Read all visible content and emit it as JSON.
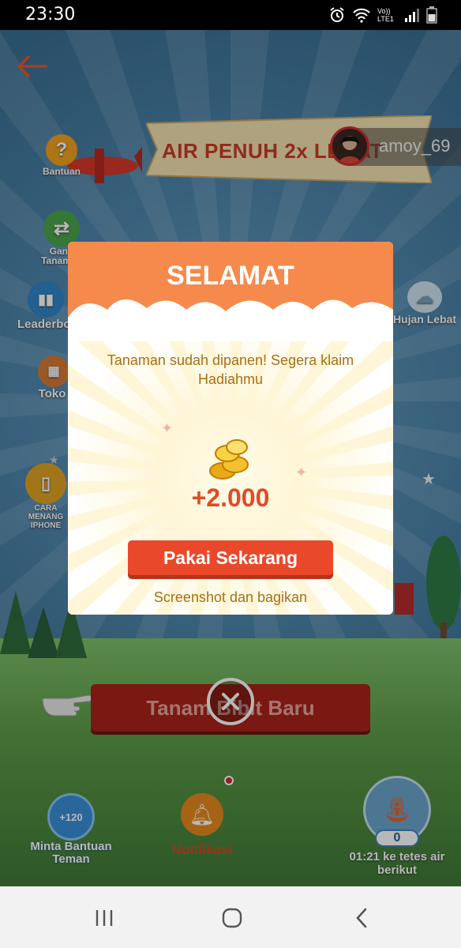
{
  "status_bar": {
    "time": "23:30",
    "network_label": "Vo)) LTE1"
  },
  "game": {
    "banner_text": "AIR PENUH 2x LEBAT",
    "username": "amoy_69",
    "side_menu": [
      {
        "label": "Bantuan"
      },
      {
        "label": "Ganti Tanaman"
      },
      {
        "label": "Leaderboard"
      },
      {
        "label": "Toko"
      },
      {
        "label": "CARA MENANG IPHONE"
      }
    ],
    "right_menu_label": "Hujan Lebat",
    "cta_label": "Tanam Bibit Baru",
    "bottom": {
      "ask_friends_badge": "+120",
      "ask_friends_label": "Minta Bantuan Teman",
      "notifications_label": "Notifikasi",
      "water_count": "0",
      "water_timer": "01:21 ke tetes air berikut"
    }
  },
  "modal": {
    "title": "SELAMAT",
    "message": "Tanaman sudah dipanen! Segera klaim Hadiahmu",
    "amount": "+2.000",
    "claim_button": "Pakai Sekarang",
    "share_link": "Screenshot dan bagikan"
  },
  "colors": {
    "modal_header": "#f58a4c",
    "claim_button": "#e9492a",
    "amount_text": "#e04b26",
    "message_text": "#a86f10"
  }
}
